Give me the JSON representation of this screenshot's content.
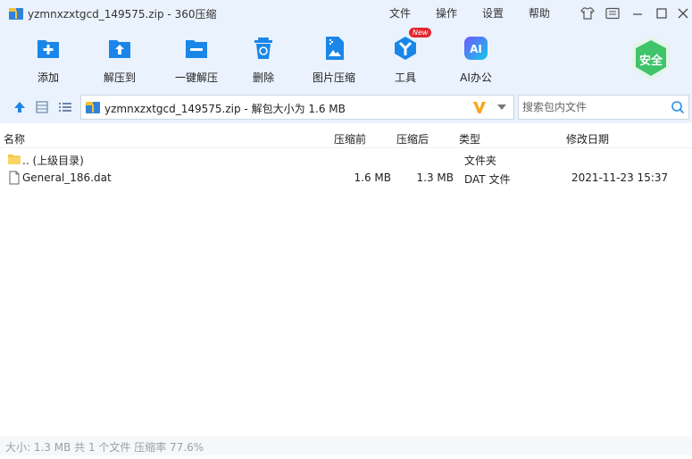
{
  "window": {
    "title": "yzmnxzxtgcd_149575.zip - 360压缩",
    "menus": [
      "文件",
      "操作",
      "设置",
      "帮助"
    ]
  },
  "toolbar": {
    "buttons": [
      {
        "label": "添加",
        "icon": "add-icon"
      },
      {
        "label": "解压到",
        "icon": "extract-to-icon"
      },
      {
        "label": "一键解压",
        "icon": "one-click-extract-icon"
      },
      {
        "label": "删除",
        "icon": "delete-icon"
      },
      {
        "label": "图片压缩",
        "icon": "image-compress-icon"
      },
      {
        "label": "工具",
        "icon": "tools-icon"
      },
      {
        "label": "AI办公",
        "icon": "ai-office-icon"
      }
    ],
    "new_badge": "New",
    "safe_badge": "安全"
  },
  "address": {
    "path": "yzmnxzxtgcd_149575.zip - 解包大小为 1.6 MB",
    "search_placeholder": "搜索包内文件"
  },
  "columns": {
    "name": "名称",
    "before": "压缩前",
    "after": "压缩后",
    "type": "类型",
    "modified": "修改日期"
  },
  "files": [
    {
      "name": ".. (上级目录)",
      "before": "",
      "after": "",
      "type": "文件夹",
      "modified": "",
      "icon": "folder-icon"
    },
    {
      "name": "General_186.dat",
      "before": "1.6 MB",
      "after": "1.3 MB",
      "type": "DAT 文件",
      "modified": "2021-11-23 15:37",
      "icon": "file-icon"
    }
  ],
  "status": {
    "text": "大小: 1.3 MB 共 1 个文件 压缩率 77.6%"
  },
  "colors": {
    "chrome_bg": "#e9f2fd",
    "accent_blue": "#1a86e8",
    "safe_green": "#3fc46a"
  }
}
